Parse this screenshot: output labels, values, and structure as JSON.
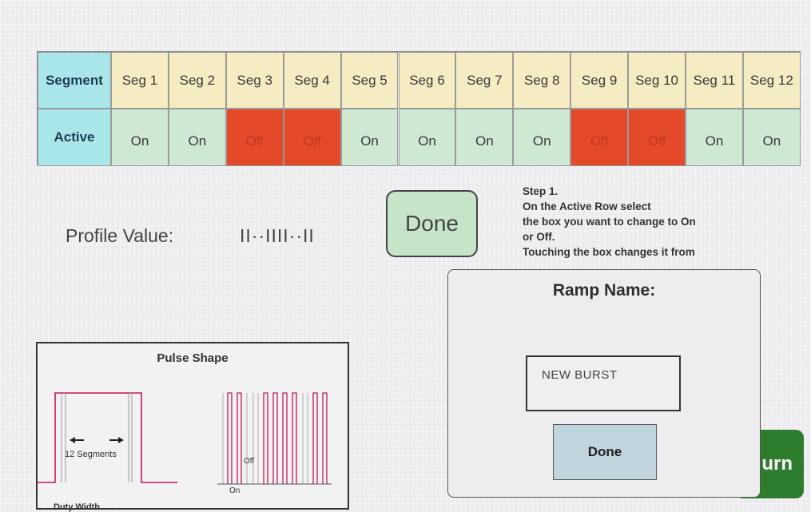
{
  "segment_table": {
    "segment_header": "Segment",
    "active_header": "Active",
    "segments": [
      "Seg 1",
      "Seg 2",
      "Seg 3",
      "Seg 4",
      "Seg 5",
      "Seg 6",
      "Seg 7",
      "Seg 8",
      "Seg 9",
      "Seg 10",
      "Seg 11",
      "Seg 12"
    ],
    "active": [
      "On",
      "On",
      "Off",
      "Off",
      "On",
      "On",
      "On",
      "On",
      "Off",
      "Off",
      "On",
      "On"
    ]
  },
  "profile": {
    "label": "Profile Value:",
    "value": "II··IIII··II"
  },
  "done_button": "Done",
  "instructions": [
    "Step 1.",
    "On the Active Row select",
    "the box you want to change to On",
    " or Off.",
    "Touching the box changes it from"
  ],
  "pulse_panel": {
    "title": "Pulse Shape",
    "segments_label": "12 Segments",
    "off_label": "Off",
    "on_label": "On",
    "cut_off_label": "Duty Width"
  },
  "ramp_dialog": {
    "title": "Ramp Name:",
    "input_value": "NEW  BURST",
    "done_label": "Done"
  },
  "return_button": "urn",
  "colors": {
    "header_cyan": "#a8e6ea",
    "segment_yellow": "#f6ecc2",
    "on_green": "#cfe8d3",
    "off_red": "#e4492a",
    "done_green": "#c6e4c8",
    "dialog_done_blue": "#bfd4dc",
    "return_green": "#2e7d2e",
    "pulse_line": "#c2185b"
  }
}
